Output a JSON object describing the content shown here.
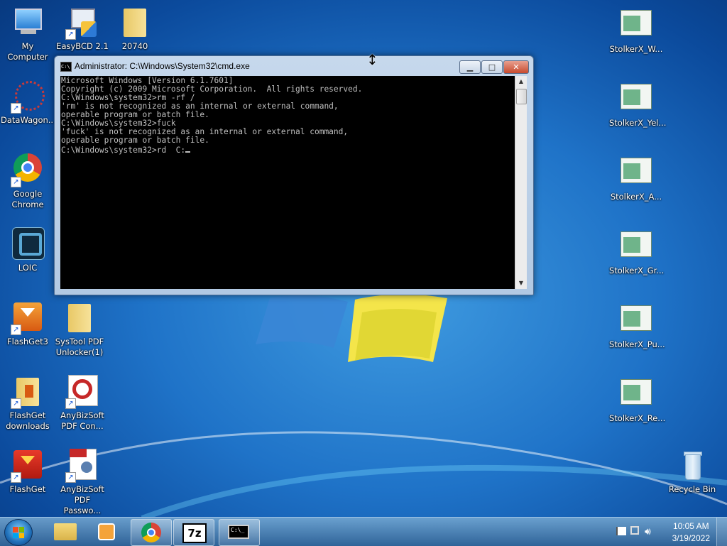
{
  "desktop": {
    "left_icons": [
      {
        "label": "My Computer",
        "icon": "computer-icon"
      },
      {
        "label": "EasyBCD 2.1",
        "icon": "easybcd-icon"
      },
      {
        "label": "20740",
        "icon": "folder-icon"
      },
      {
        "label": "DataWagon...",
        "icon": "datawagon-icon"
      },
      {
        "label": "Google Chrome",
        "icon": "chrome-icon"
      },
      {
        "label": "LOIC",
        "icon": "loic-icon"
      },
      {
        "label": "FlashGet3",
        "icon": "flashget3-icon"
      },
      {
        "label": "SysTool PDF Unlocker(1)",
        "icon": "folder-icon"
      },
      {
        "label": "FlashGet downloads",
        "icon": "folder-icon"
      },
      {
        "label": "AnyBizSoft PDF Con...",
        "icon": "anybizsoft-icon"
      },
      {
        "label": "FlashGet",
        "icon": "flashget-icon"
      },
      {
        "label": "AnyBizSoft PDF Passwo...",
        "icon": "pdf-password-icon"
      }
    ],
    "right_icons": [
      {
        "label": "StolkerX_W...",
        "icon": "window-document-icon"
      },
      {
        "label": "StolkerX_Yel...",
        "icon": "window-document-icon"
      },
      {
        "label": "StolkerX_A...",
        "icon": "window-document-icon"
      },
      {
        "label": "StolkerX_Gr...",
        "icon": "window-document-icon"
      },
      {
        "label": "StolkerX_Pu...",
        "icon": "window-document-icon"
      },
      {
        "label": "StolkerX_Re...",
        "icon": "window-document-icon"
      },
      {
        "label": "Recycle Bin",
        "icon": "recycle-bin-icon"
      }
    ]
  },
  "cmd": {
    "title": "Administrator: C:\\Windows\\System32\\cmd.exe",
    "icon_text": "C:\\",
    "lines": [
      "Microsoft Windows [Version 6.1.7601]",
      "Copyright (c) 2009 Microsoft Corporation.  All rights reserved.",
      "",
      "C:\\Windows\\system32>rm -rf /",
      "'rm' is not recognized as an internal or external command,",
      "operable program or batch file.",
      "",
      "C:\\Windows\\system32>fuck",
      "'fuck' is not recognized as an internal or external command,",
      "operable program or batch file.",
      "",
      "C:\\Windows\\system32>rd  C:"
    ],
    "minimize": "▁",
    "maximize": "□",
    "close": "✕"
  },
  "taskbar": {
    "items": [
      {
        "name": "explorer",
        "icon": "folder-icon",
        "open": false
      },
      {
        "name": "media",
        "icon": "media-player-icon",
        "open": false
      },
      {
        "name": "chrome",
        "icon": "chrome-icon",
        "open": true
      },
      {
        "name": "7zip",
        "icon": "7zip-icon",
        "label": "7z",
        "open": true
      },
      {
        "name": "cmd",
        "icon": "cmd-icon",
        "label": "C:\\_",
        "open": true
      }
    ],
    "clock_time": "10:05 AM",
    "clock_date": "3/19/2022"
  },
  "colors": {
    "desktop": "#1f73c8",
    "console_bg": "#000000",
    "console_fg": "#c0c0c0"
  }
}
